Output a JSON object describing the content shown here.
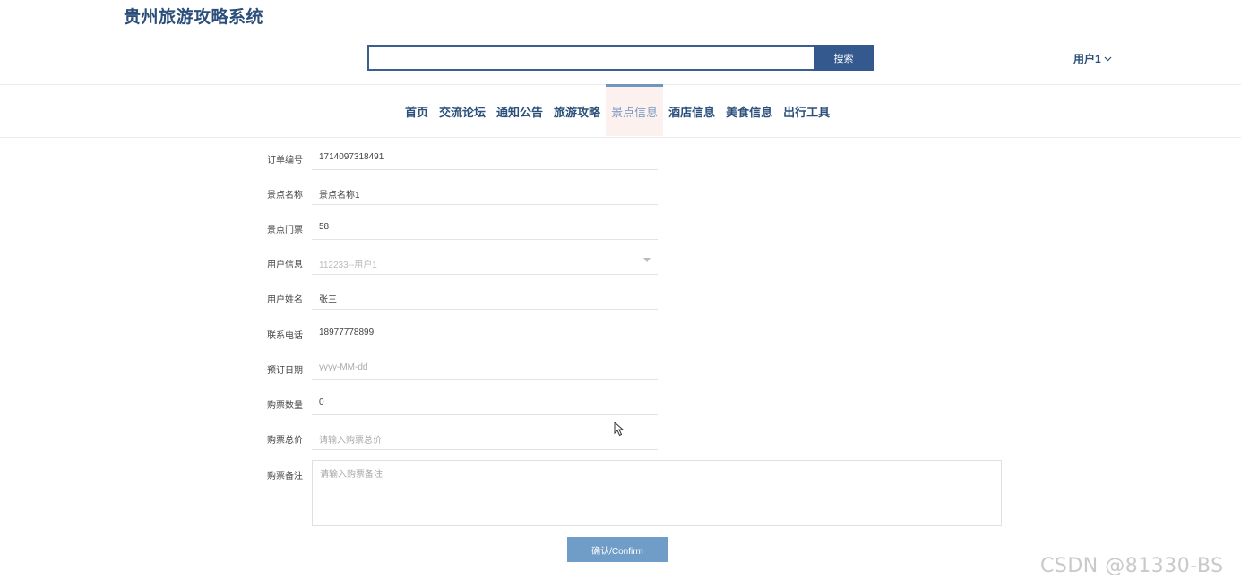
{
  "site": {
    "title": "贵州旅游攻略系统"
  },
  "search": {
    "placeholder": "",
    "button_label": "搜索"
  },
  "user_menu": {
    "label": "用户1",
    "icon": "chevron-down-icon"
  },
  "nav": {
    "items": [
      {
        "label": "首页"
      },
      {
        "label": "交流论坛"
      },
      {
        "label": "通知公告"
      },
      {
        "label": "旅游攻略"
      },
      {
        "label": "景点信息",
        "active": true
      },
      {
        "label": "酒店信息"
      },
      {
        "label": "美食信息"
      },
      {
        "label": "出行工具"
      }
    ]
  },
  "form": {
    "order_no": {
      "label": "订单编号",
      "value": "1714097318491"
    },
    "spot_name": {
      "label": "景点名称",
      "value": "景点名称1"
    },
    "ticket_price": {
      "label": "景点门票",
      "value": "58"
    },
    "user_info": {
      "label": "用户信息",
      "value": "112233--用户1"
    },
    "user_name": {
      "label": "用户姓名",
      "value": "张三"
    },
    "phone": {
      "label": "联系电话",
      "value": "18977778899"
    },
    "booking_date": {
      "label": "预订日期",
      "placeholder": "yyyy-MM-dd"
    },
    "quantity": {
      "label": "购票数量",
      "value": "0"
    },
    "total_price": {
      "label": "购票总价",
      "placeholder": "请输入购票总价"
    },
    "remark": {
      "label": "购票备注",
      "placeholder": "请输入购票备注"
    },
    "confirm_label": "确认/Confirm"
  },
  "watermark": "CSDN @81330-BS",
  "colors": {
    "brand": "#2b4f7a",
    "search_button": "#33598e",
    "confirm_button": "#6f9dc8",
    "active_tab_bg": "#fdf1ef"
  }
}
